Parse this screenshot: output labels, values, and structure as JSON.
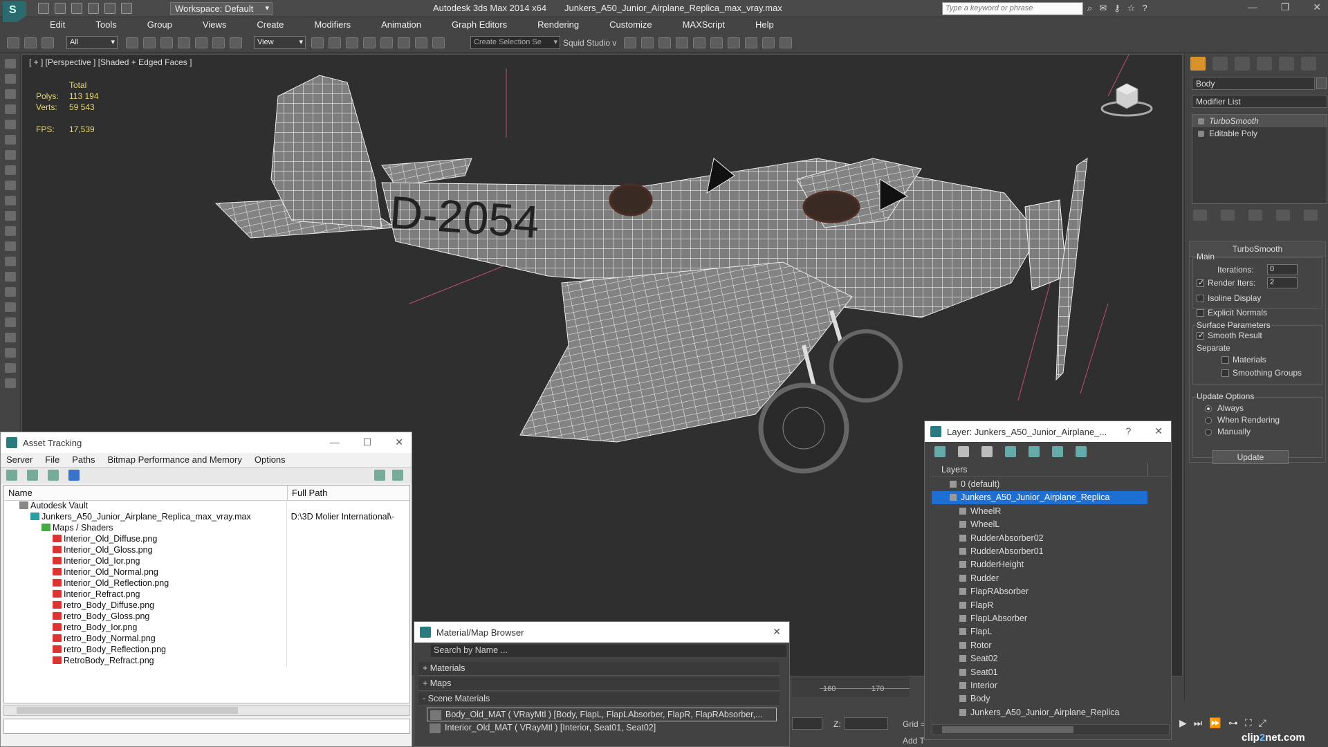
{
  "titlebar": {
    "logo": "S",
    "workspace": "Workspace: Default",
    "app_title": "Autodesk 3ds Max  2014 x64",
    "file_title": "Junkers_A50_Junior_Airplane_Replica_max_vray.max",
    "search_placeholder": "Type a keyword or phrase"
  },
  "menu": [
    "Edit",
    "Tools",
    "Group",
    "Views",
    "Create",
    "Modifiers",
    "Animation",
    "Graph Editors",
    "Rendering",
    "Customize",
    "MAXScript",
    "Help"
  ],
  "toolbar": {
    "selection_filter": "All",
    "reference_coord": "View",
    "named_selection": "Create Selection Se",
    "squid": "Squid Studio v"
  },
  "viewport": {
    "label": "[ + ] [Perspective ] [Shaded + Edged Faces ]",
    "stats_header": "Total",
    "polys_label": "Polys:",
    "polys_value": "113 194",
    "verts_label": "Verts:",
    "verts_value": "59 543",
    "fps_label": "FPS:",
    "fps_value": "17,539",
    "tail_marking": "D-2054"
  },
  "command_panel": {
    "object_name": "Body",
    "modifier_list": "Modifier List",
    "stack": [
      "TurboSmooth",
      "Editable Poly"
    ],
    "rollout_title": "TurboSmooth",
    "main_label": "Main",
    "iterations_label": "Iterations:",
    "iterations_value": "0",
    "render_iters_label": "Render Iters:",
    "render_iters_value": "2",
    "isoline": "Isoline Display",
    "explicit_normals": "Explicit Normals",
    "surface_params": "Surface Parameters",
    "smooth_result": "Smooth Result",
    "separate": "Separate",
    "materials": "Materials",
    "smoothing_groups": "Smoothing Groups",
    "update_options": "Update Options",
    "always": "Always",
    "when_rendering": "When Rendering",
    "manually": "Manually",
    "update_button": "Update"
  },
  "asset_tracking": {
    "title": "Asset Tracking",
    "menu": [
      "Server",
      "File",
      "Paths",
      "Bitmap Performance and Memory",
      "Options"
    ],
    "col_name": "Name",
    "col_path": "Full Path",
    "rows": [
      {
        "name": "Autodesk Vault",
        "path": "",
        "indent": 1,
        "icon": "vault"
      },
      {
        "name": "Junkers_A50_Junior_Airplane_Replica_max_vray.max",
        "path": "D:\\3D Molier International\\-",
        "indent": 2,
        "icon": "max"
      },
      {
        "name": "Maps / Shaders",
        "path": "",
        "indent": 3,
        "icon": "folder"
      },
      {
        "name": "Interior_Old_Diffuse.png",
        "path": "",
        "indent": 4,
        "icon": "png"
      },
      {
        "name": "Interior_Old_Gloss.png",
        "path": "",
        "indent": 4,
        "icon": "png"
      },
      {
        "name": "Interior_Old_Ior.png",
        "path": "",
        "indent": 4,
        "icon": "png"
      },
      {
        "name": "Interior_Old_Normal.png",
        "path": "",
        "indent": 4,
        "icon": "png"
      },
      {
        "name": "Interior_Old_Reflection.png",
        "path": "",
        "indent": 4,
        "icon": "png"
      },
      {
        "name": "Interior_Refract.png",
        "path": "",
        "indent": 4,
        "icon": "png"
      },
      {
        "name": "retro_Body_Diffuse.png",
        "path": "",
        "indent": 4,
        "icon": "png"
      },
      {
        "name": "retro_Body_Gloss.png",
        "path": "",
        "indent": 4,
        "icon": "png"
      },
      {
        "name": "retro_Body_Ior.png",
        "path": "",
        "indent": 4,
        "icon": "png"
      },
      {
        "name": "retro_Body_Normal.png",
        "path": "",
        "indent": 4,
        "icon": "png"
      },
      {
        "name": "retro_Body_Reflection.png",
        "path": "",
        "indent": 4,
        "icon": "png"
      },
      {
        "name": "RetroBody_Refract.png",
        "path": "",
        "indent": 4,
        "icon": "png"
      }
    ]
  },
  "material_browser": {
    "title": "Material/Map Browser",
    "search_placeholder": "Search by Name ...",
    "sections": [
      "+ Materials",
      "+ Maps",
      "- Scene Materials"
    ],
    "items": [
      "Body_Old_MAT ( VRayMtl ) [Body, FlapL, FlapLAbsorber, FlapR, FlapRAbsorber,...",
      "Interior_Old_MAT ( VRayMtl ) [Interior, Seat01, Seat02]"
    ]
  },
  "layer_explorer": {
    "title": "Layer: Junkers_A50_Junior_Airplane_...",
    "help": "?",
    "col_layers": "Layers",
    "rows": [
      {
        "name": "0 (default)",
        "level": 0,
        "selected": false
      },
      {
        "name": "Junkers_A50_Junior_Airplane_Replica",
        "level": 0,
        "selected": true
      },
      {
        "name": "WheelR",
        "level": 1,
        "selected": false
      },
      {
        "name": "WheelL",
        "level": 1,
        "selected": false
      },
      {
        "name": "RudderAbsorber02",
        "level": 1,
        "selected": false
      },
      {
        "name": "RudderAbsorber01",
        "level": 1,
        "selected": false
      },
      {
        "name": "RudderHeight",
        "level": 1,
        "selected": false
      },
      {
        "name": "Rudder",
        "level": 1,
        "selected": false
      },
      {
        "name": "FlapRAbsorber",
        "level": 1,
        "selected": false
      },
      {
        "name": "FlapR",
        "level": 1,
        "selected": false
      },
      {
        "name": "FlapLAbsorber",
        "level": 1,
        "selected": false
      },
      {
        "name": "FlapL",
        "level": 1,
        "selected": false
      },
      {
        "name": "Rotor",
        "level": 1,
        "selected": false
      },
      {
        "name": "Seat02",
        "level": 1,
        "selected": false
      },
      {
        "name": "Seat01",
        "level": 1,
        "selected": false
      },
      {
        "name": "Interior",
        "level": 1,
        "selected": false
      },
      {
        "name": "Body",
        "level": 1,
        "selected": false
      },
      {
        "name": "Junkers_A50_Junior_Airplane_Replica",
        "level": 1,
        "selected": false
      }
    ]
  },
  "timeline": {
    "tick_160": "160",
    "tick_170": "170"
  },
  "bottom": {
    "z_label": "Z:",
    "grid_label": "Grid =",
    "add_time_tag": "Add T"
  },
  "watermark": {
    "a": "clip",
    "b": "2",
    "c": "net.com"
  },
  "colors": {
    "selection": "#1d6fd4",
    "stats_text": "#e6d56b",
    "viewport_bg": "#2f2f2f"
  }
}
